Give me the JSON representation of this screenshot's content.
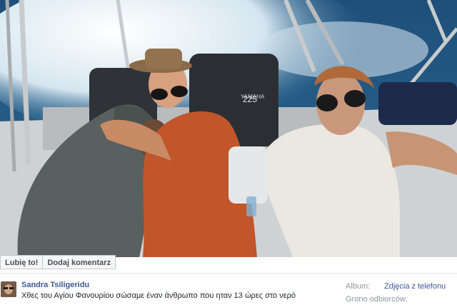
{
  "actions": {
    "like_label": "Lubię to!",
    "comment_label": "Dodaj komentarz"
  },
  "post": {
    "author": "Sandra Tsiligeridu",
    "caption": "Χθες του Αγίου Φανουρίου σώσαμε έναν άνθρωπο που ηταν 13 ώρες στο νερό"
  },
  "sidebar": {
    "album_label": "Album:",
    "album_name": "Zdjęcia z telefonu",
    "audience_label": "Grono odbiorców:"
  },
  "photo": {
    "engine_badge": "225",
    "engine_brand": "YAMAHA"
  }
}
